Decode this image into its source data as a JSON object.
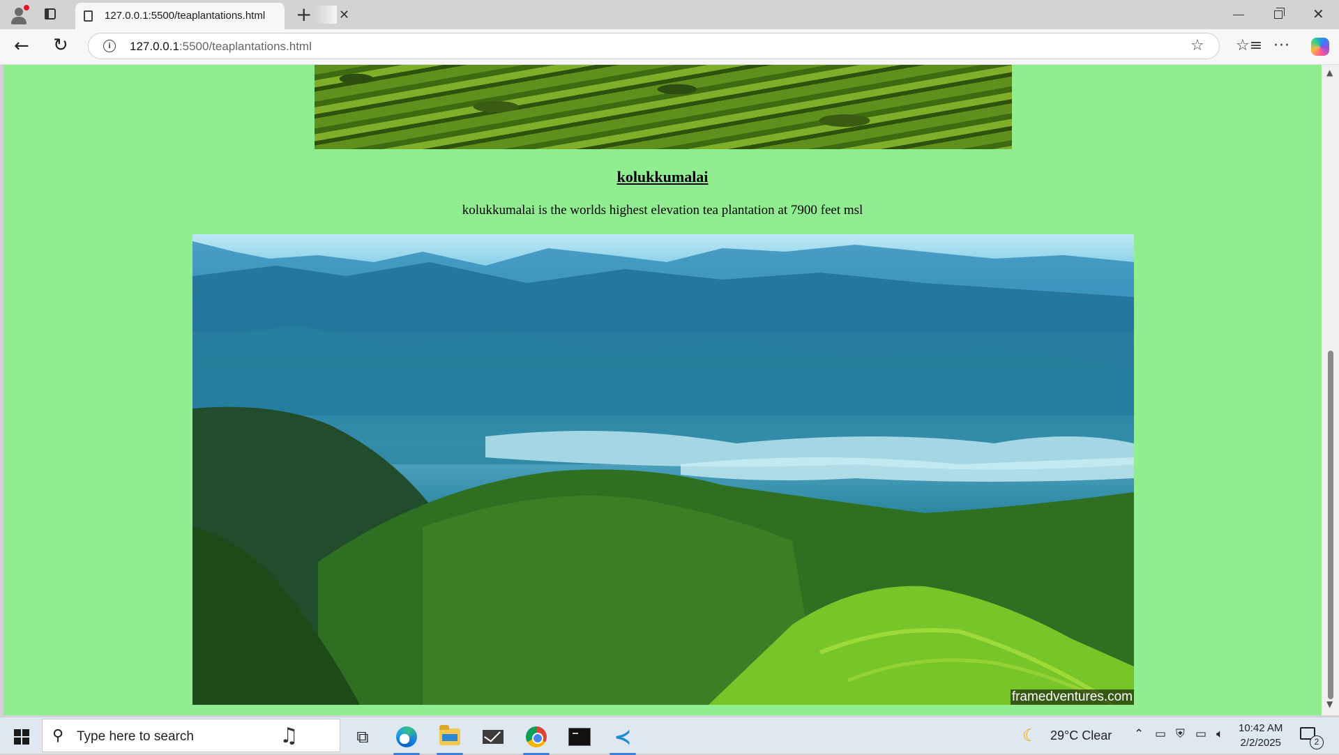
{
  "browser": {
    "tab_title": "127.0.0.1:5500/teaplantations.html",
    "tab_close_glyph": "✕",
    "new_tab_glyph": "+",
    "url_host": "127.0.0.1",
    "url_rest": ":5500/teaplantations.html",
    "icons": [
      "profile-icon",
      "tab-actions-icon",
      "page-icon",
      "back-icon",
      "reload-icon",
      "site-info-icon",
      "favorite-star-icon",
      "favorites-icon",
      "more-icon",
      "copilot-icon"
    ]
  },
  "page": {
    "background_color": "#90ee90",
    "heading": "kolukkumalai",
    "description": "kolukkumalai is the worlds highest elevation tea plantation at 7900 feet msl",
    "image_watermark": "framedventures.com"
  },
  "taskbar": {
    "search_placeholder": "Type here to search",
    "weather_temp": "29°C  Clear",
    "time": "10:42 AM",
    "date": "2/2/2025",
    "notification_count": "2",
    "apps": [
      "task-view",
      "edge",
      "file-explorer",
      "mail",
      "chrome",
      "terminal",
      "vscode"
    ]
  }
}
